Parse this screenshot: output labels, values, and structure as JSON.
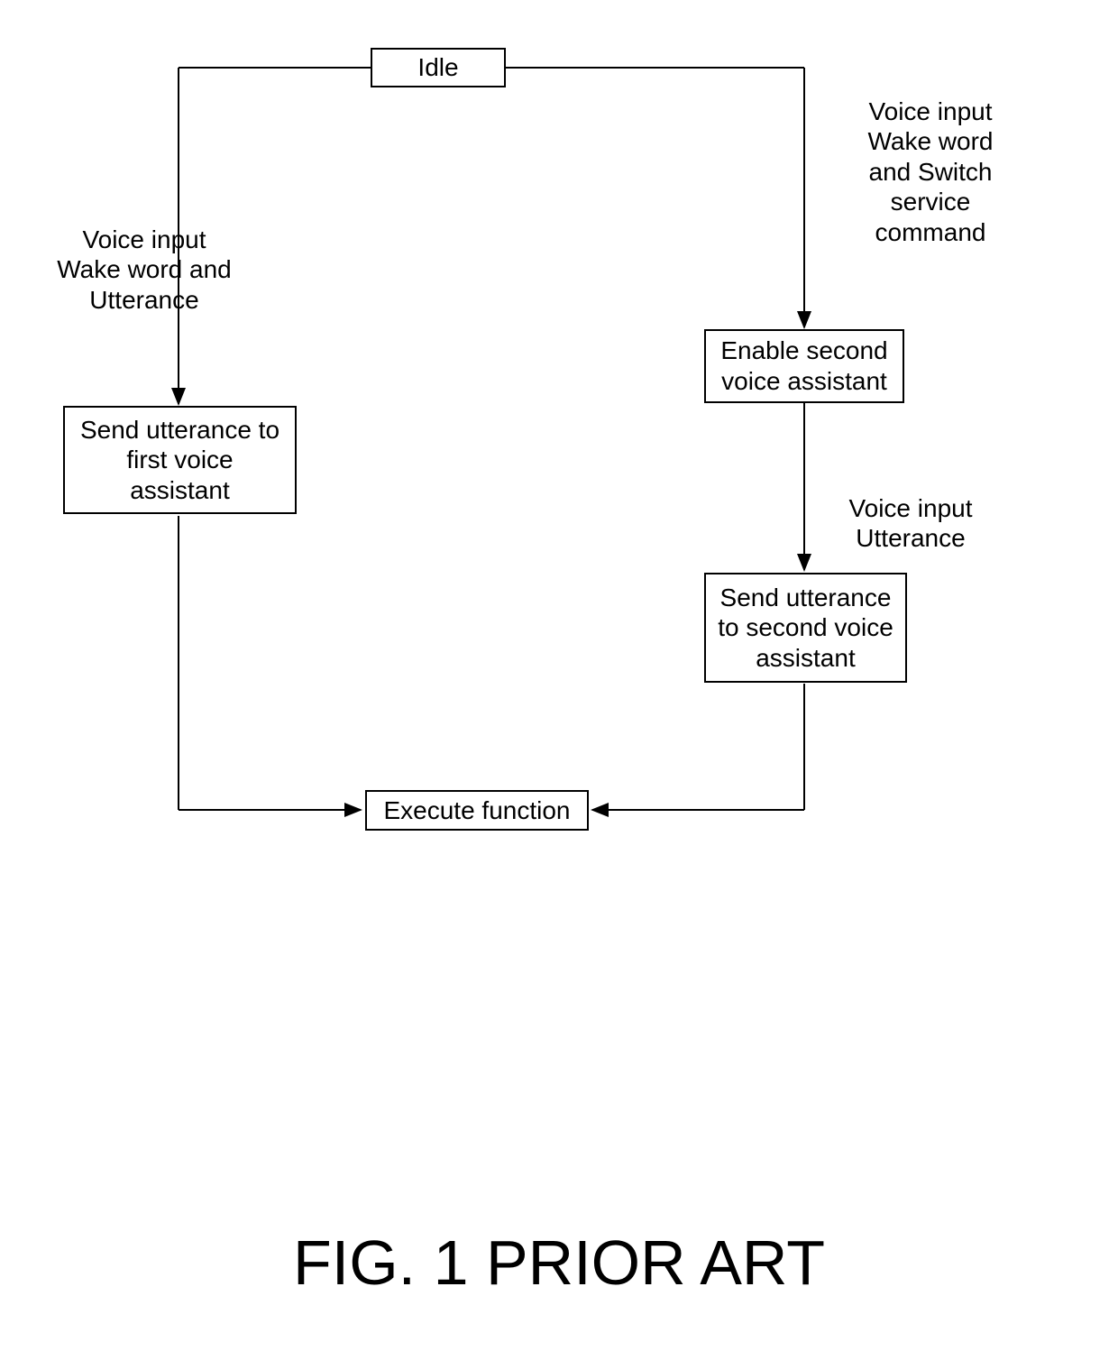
{
  "boxes": {
    "idle": "Idle",
    "send_first": "Send utterance to\nfirst voice\nassistant",
    "enable_second": "Enable second\nvoice assistant",
    "send_second": "Send utterance\nto second voice\nassistant",
    "execute": "Execute function"
  },
  "labels": {
    "left_edge": "Voice input\nWake word and\nUtterance",
    "right_edge_top": "Voice input\nWake word\nand Switch\nservice\ncommand",
    "right_edge_mid": "Voice input\nUtterance"
  },
  "caption": "FIG. 1 PRIOR ART"
}
